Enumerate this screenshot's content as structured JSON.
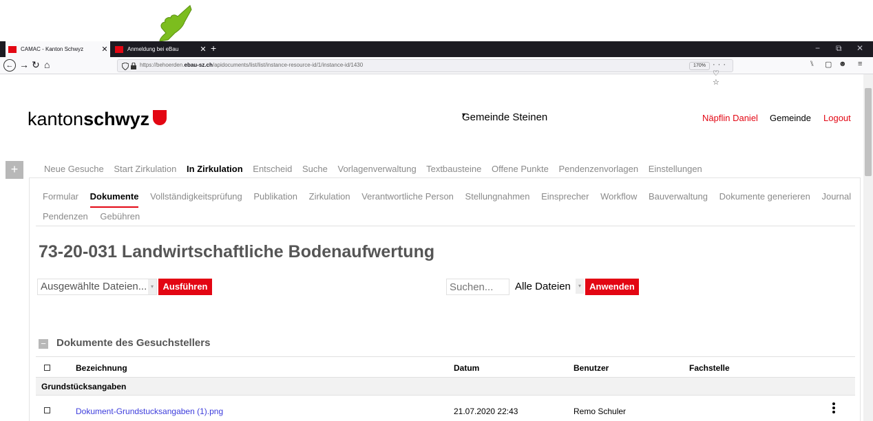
{
  "browser": {
    "tabs": [
      {
        "title": "CAMAC - Kanton Schwyz",
        "close": "✕",
        "favicon_color": "#e30613"
      },
      {
        "title": "Anmeldung bei eBau",
        "close": "✕",
        "favicon_color": "#e30613"
      }
    ],
    "new_tab": "+",
    "window_controls": {
      "minimize": "−",
      "restore": "⧉",
      "close": "✕"
    },
    "url": {
      "prefix": "https://behoerden.",
      "host": "ebau-sz.ch",
      "path": "/apidocuments/list/list/instance-resource-id/1/instance-id/1430"
    },
    "zoom": "170%",
    "url_icons": "··· ♡ ☆",
    "nav_glyphs": {
      "back": "←",
      "forward": "→",
      "reload": "↻",
      "home": "⌂"
    },
    "toolbar_glyphs": {
      "library": "⑊",
      "sidebar": "▢",
      "account": "☻",
      "menu": "≡"
    }
  },
  "header": {
    "logo_light": "kanton",
    "logo_bold": "schwyz",
    "gemeinde_select": "Gemeinde Steinen",
    "select_caret": "▾",
    "user": "Näpflin Daniel",
    "role": "Gemeinde",
    "logout": "Logout"
  },
  "plus_label": "+",
  "main_nav": [
    {
      "label": "Neue Gesuche",
      "active": false
    },
    {
      "label": "Start Zirkulation",
      "active": false
    },
    {
      "label": "In Zirkulation",
      "active": true
    },
    {
      "label": "Entscheid",
      "active": false
    },
    {
      "label": "Suche",
      "active": false
    },
    {
      "label": "Vorlagenverwaltung",
      "active": false
    },
    {
      "label": "Textbausteine",
      "active": false
    },
    {
      "label": "Offene Punkte",
      "active": false
    },
    {
      "label": "Pendenzenvorlagen",
      "active": false
    },
    {
      "label": "Einstellungen",
      "active": false
    }
  ],
  "sub_nav": [
    {
      "label": "Formular",
      "active": false
    },
    {
      "label": "Dokumente",
      "active": true
    },
    {
      "label": "Vollständigkeitsprüfung",
      "active": false
    },
    {
      "label": "Publikation",
      "active": false
    },
    {
      "label": "Zirkulation",
      "active": false
    },
    {
      "label": "Verantwortliche Person",
      "active": false
    },
    {
      "label": "Stellungnahmen",
      "active": false
    },
    {
      "label": "Einsprecher",
      "active": false
    },
    {
      "label": "Workflow",
      "active": false
    },
    {
      "label": "Bauverwaltung",
      "active": false
    },
    {
      "label": "Dokumente generieren",
      "active": false
    },
    {
      "label": "Journal",
      "active": false
    }
  ],
  "sub_nav_row2": [
    {
      "label": "Pendenzen"
    },
    {
      "label": "Gebühren"
    }
  ],
  "page_title": "73-20-031 Landwirtschaftliche Bodenaufwertung",
  "actions": {
    "selected_files": "Ausgewählte Dateien...",
    "execute": "Ausführen",
    "search_placeholder": "Suchen...",
    "filter": "Alle Dateien",
    "apply": "Anwenden",
    "caret": "▾"
  },
  "section": {
    "toggle": "−",
    "title": "Dokumente des Gesuchstellers"
  },
  "table": {
    "columns": [
      "Bezeichnung",
      "Datum",
      "Benutzer",
      "Fachstelle"
    ],
    "group": "Grundstücksangaben",
    "rows": [
      {
        "name": "Dokument-Grundstucksangaben (1).png",
        "date": "21.07.2020 22:43",
        "user": "Remo Schuler",
        "fachstelle": ""
      }
    ]
  },
  "colors": {
    "accent": "#e30613",
    "link": "#3c3cdc",
    "cursor": "#7cbd1e"
  }
}
